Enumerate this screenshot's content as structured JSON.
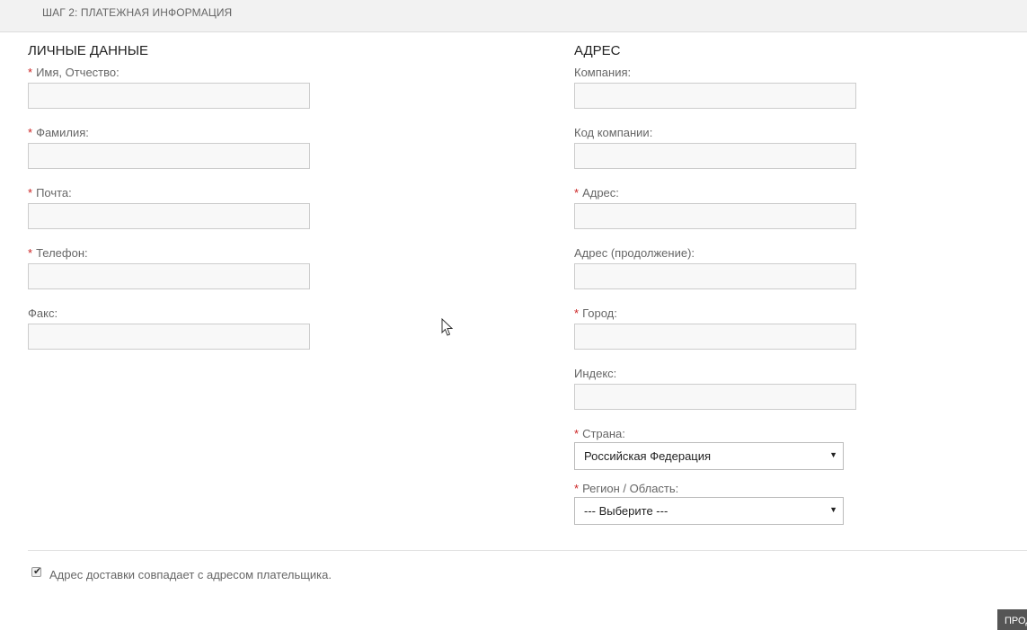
{
  "header": {
    "step_title": "ШАГ 2: ПЛАТЕЖНАЯ ИНФОРМАЦИЯ"
  },
  "personal": {
    "section_title": "ЛИЧНЫЕ ДАННЫЕ",
    "fields": [
      {
        "label": "Имя, Отчество:",
        "required": true,
        "value": ""
      },
      {
        "label": "Фамилия:",
        "required": true,
        "value": ""
      },
      {
        "label": "Почта:",
        "required": true,
        "value": ""
      },
      {
        "label": "Телефон:",
        "required": true,
        "value": ""
      },
      {
        "label": "Факс:",
        "required": false,
        "value": ""
      }
    ]
  },
  "address": {
    "section_title": "АДРЕС",
    "fields": [
      {
        "label": "Компания:",
        "required": false,
        "value": ""
      },
      {
        "label": "Код компании:",
        "required": false,
        "value": ""
      },
      {
        "label": "Адрес:",
        "required": true,
        "value": ""
      },
      {
        "label": "Адрес (продолжение):",
        "required": false,
        "value": ""
      },
      {
        "label": "Город:",
        "required": true,
        "value": ""
      },
      {
        "label": "Индекс:",
        "required": false,
        "value": ""
      }
    ],
    "country": {
      "label": "Страна:",
      "required": true,
      "selected": "Российская Федерация"
    },
    "region": {
      "label": "Регион / Область:",
      "required": true,
      "selected": "--- Выберите ---"
    }
  },
  "required_marker": "*",
  "shipping_same": {
    "label": "Адрес доставки совпадает с адресом плательщика.",
    "checked": true,
    "check_glyph": "✔"
  },
  "continue_button": {
    "label": "ПРОДОЛЖИТЬ"
  },
  "select_arrow_glyph": "▼",
  "colors": {
    "required": "#cc2222",
    "header_bg": "#f2f2f2",
    "button_bg": "#555555"
  }
}
